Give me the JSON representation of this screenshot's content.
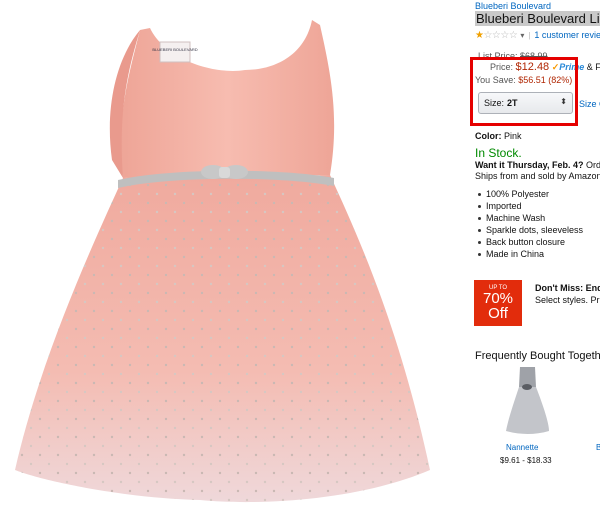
{
  "product": {
    "brand": "Blueberi Boulevard",
    "title": "Blueberi Boulevard Li",
    "rating": {
      "stars_filled": 1,
      "stars_total": 5,
      "reviews_label": "1 customer revie"
    },
    "list_price_label": "List Price:",
    "list_price": "$68.99",
    "price_label": "Price:",
    "price": "$12.48",
    "prime_label": "Prime",
    "free_shipping_fragment": "& Fr",
    "save_label": "You Save:",
    "save_value": "$56.51 (82%)",
    "size": {
      "label": "Size:",
      "value": "2T",
      "chart_link": "Size C"
    },
    "color": {
      "label": "Color:",
      "value": "Pink"
    },
    "stock_status": "In Stock.",
    "delivery": {
      "want_label": "Want it Thursday, Feb. 4?",
      "order_fragment": "Order w"
    },
    "ships_from": "Ships from and sold by Amazon.c",
    "features": [
      "100% Polyester",
      "Imported",
      "Machine Wash",
      "Sparkle dots, sleeveless",
      "Back button closure",
      "Made in China"
    ]
  },
  "promo": {
    "badge_upto": "UP TO",
    "badge_percent": "70%",
    "badge_off": "Off",
    "headline": "Don't Miss: End-",
    "subtext": "Select styles. Pric"
  },
  "frequently_bought": {
    "title": "Frequently Bought Togethe",
    "items": [
      {
        "name": "Nannette",
        "price": "$9.61 - $18.33"
      },
      {
        "name": "B"
      }
    ]
  },
  "image": {
    "tag_text": "BLUEBERI BOULEVARD"
  },
  "colors": {
    "accent_red": "#e50000",
    "link_blue": "#0066c0",
    "price_red": "#b12704",
    "stock_green": "#008a00",
    "dress_pink": "#f0b0a6"
  }
}
